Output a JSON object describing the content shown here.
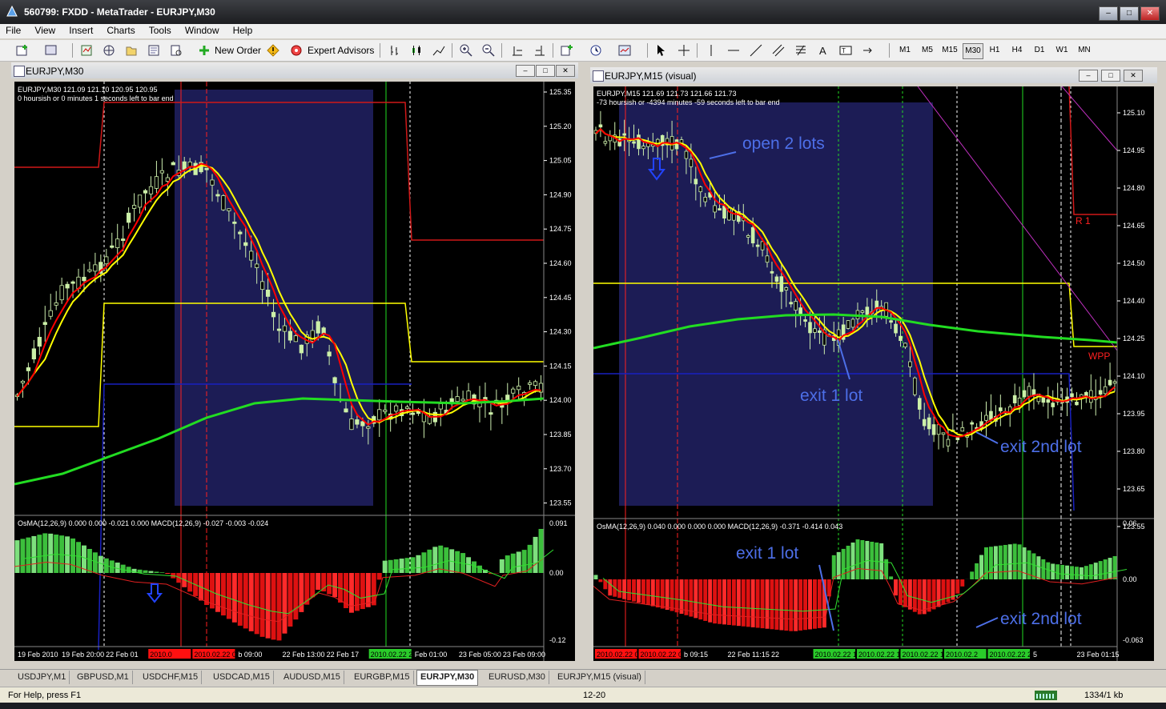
{
  "window": {
    "title": "560799: FXDD - MetaTrader - EURJPY,M30"
  },
  "menu": [
    "File",
    "View",
    "Insert",
    "Charts",
    "Tools",
    "Window",
    "Help"
  ],
  "toolbar": {
    "new_order": "New Order",
    "expert_advisors": "Expert Advisors",
    "timeframes": [
      "M1",
      "M5",
      "M15",
      "M30",
      "H1",
      "H4",
      "D1",
      "W1",
      "MN"
    ],
    "active_timeframe": "M30"
  },
  "left_chart": {
    "window_title": "EURJPY,M30",
    "header_line1": "EURJPY,M30  121.09 121.10 120.95 120.95",
    "header_line2": "0 hoursish or 0 minutes 1 seconds left to bar end",
    "price_labels": [
      "125.35",
      "125.20",
      "125.05",
      "124.90",
      "124.75",
      "124.60",
      "124.45",
      "124.30",
      "124.15",
      "124.00",
      "123.85",
      "123.70",
      "123.55"
    ],
    "osma_label": "OsMA(12,26,9) 0.000 0.000 -0.021 0.000   MACD(12,26,9) -0.027 -0.003 -0.024",
    "osma_scale": [
      "0.091",
      "0.00",
      "-0.12"
    ],
    "time_labels": [
      "19 Feb 2010",
      "19 Feb 20:00",
      "22 Feb 01",
      "2010.0",
      "2010.02.22 08:00",
      "b 09:00",
      "22 Feb 13:00",
      "22 Feb 17",
      "2010.02.22 23:30",
      "Feb 01:00",
      "23 Feb 05:00",
      "23 Feb 09:00"
    ]
  },
  "right_chart": {
    "window_title": "EURJPY,M15 (visual)",
    "header_line1": "EURJPY,M15  121.69 121.73 121.66 121.73",
    "header_line2": "-73 hoursish or -4394 minutes -59 seconds left to bar end",
    "price_labels": [
      "125.10",
      "124.95",
      "124.80",
      "124.65",
      "124.50",
      "124.40",
      "124.25",
      "124.10",
      "123.95",
      "123.80",
      "123.65",
      "123.55"
    ],
    "annotations": [
      "open 2 lots",
      "exit 1 lot",
      "exit 2nd lot",
      "R 1",
      "WPP"
    ],
    "osma_label": "OsMA(12,26,9) 0.040 0.000 0.000 0.000   MACD(12,26,9) -0.371 -0.414 0.043",
    "osma_scale": [
      "0.06",
      "0.00",
      "-0.063"
    ],
    "osma_annotations": [
      "exit 1 lot",
      "exit 2nd lot"
    ],
    "time_labels": [
      "2010.02.22 06",
      "2010.02.22 08:30",
      "b 09:15",
      "22 Feb 11:15",
      "22",
      "2010.02.22 14:45",
      "2010.02.22 17:1",
      "2010.02.22 19:30",
      "2010.02.2",
      "2010.02.22 23:30",
      "5",
      "23 Feb 01:15"
    ]
  },
  "tabs": [
    "USDJPY,M1",
    "GBPUSD,M1",
    "USDCHF,M15",
    "USDCAD,M15",
    "AUDUSD,M15",
    "EURGBP,M15",
    "EURJPY,M30",
    "EURUSD,M30",
    "EURJPY,M15 (visual)"
  ],
  "active_tab": "EURJPY,M30",
  "status": {
    "help": "For Help, press F1",
    "profile": "12-20",
    "traffic": "1334/1 kb"
  },
  "colors": {
    "bg": "#000000",
    "bull": "#ccf0a8",
    "ma_fast": "#ff0000",
    "ma_slow": "#ffff00",
    "ma_long": "#22dd22",
    "box": "#1c1c52",
    "label_text": "#4d6fe8"
  }
}
